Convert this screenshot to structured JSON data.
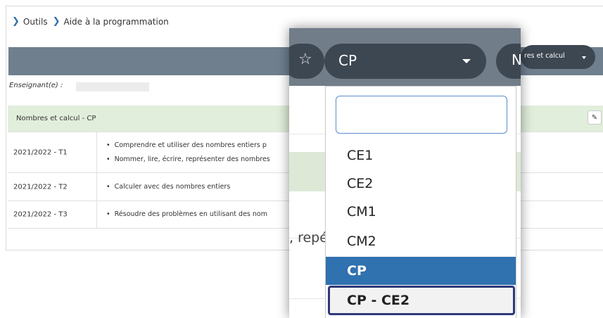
{
  "breadcrumb": {
    "items": [
      "Outils",
      "Aide à la programmation"
    ]
  },
  "teacher_label": "Enseignant(e) :",
  "section_title": "Nombres et calcul - CP",
  "rows": [
    {
      "period": "2021/2022 - T1",
      "items": [
        "Comprendre et utiliser des nombres entiers p",
        "Nommer, lire, écrire, représenter des nombres"
      ]
    },
    {
      "period": "2021/2022 - T2",
      "items": [
        "Calculer avec des nombres entiers"
      ]
    },
    {
      "period": "2021/2022 - T3",
      "items": [
        "Résoudre des problèmes en utilisant des nom"
      ]
    }
  ],
  "level_select": {
    "value": "CP",
    "search_placeholder": "",
    "options": [
      "CE1",
      "CE2",
      "CM1",
      "CM2",
      "CP",
      "CP - CE2"
    ],
    "selected": "CP",
    "focused": "CP - CE2"
  },
  "domain_select": {
    "value_partial": "res et calcul",
    "zoom_partial": "N"
  },
  "zoom_snippet": ", repé",
  "icons": {
    "favorite": "star-outline-icon",
    "edit": "pencil-icon",
    "breadcrumb_separator": "chevron-right-icon",
    "dropdown_caret": "caret-down-icon"
  },
  "colors": {
    "accent": "#3071b0",
    "focus_border": "#2d3a75",
    "pill_dark": "#3d4752",
    "header_gray": "#6f7f8e",
    "section_green": "#e1eedb"
  }
}
